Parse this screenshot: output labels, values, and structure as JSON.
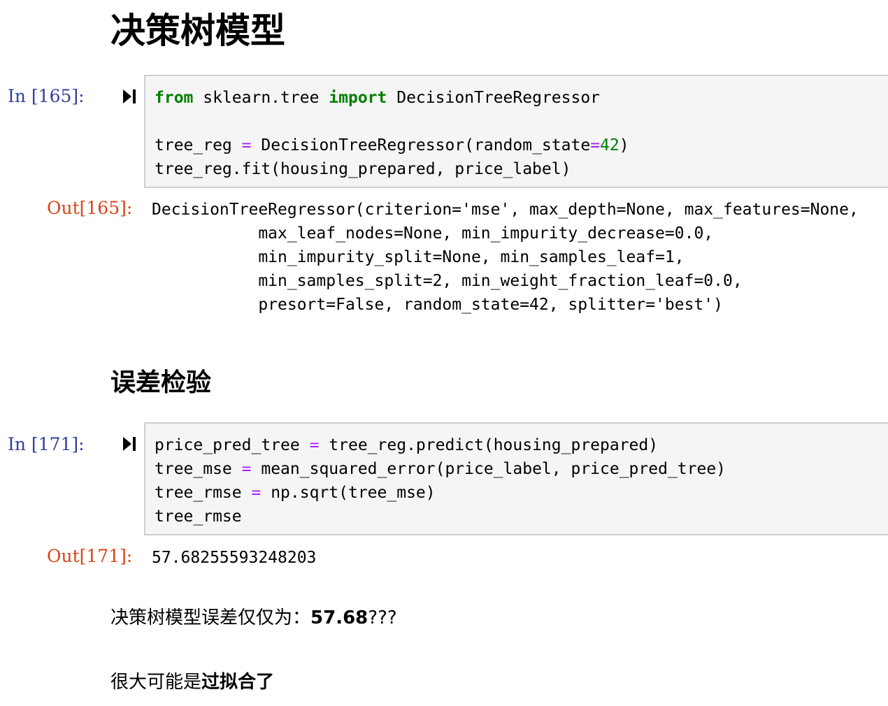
{
  "section1": {
    "heading": "决策树模型",
    "cell": {
      "in_prompt": "In [165]:",
      "code": {
        "l1_kw_from": "from",
        "l1_module": "sklearn.tree",
        "l1_kw_import": "import",
        "l1_name": "DecisionTreeRegressor",
        "l3_var": "tree_reg",
        "l3_op": "=",
        "l3_call": "DecisionTreeRegressor(random_state",
        "l3_op2": "=",
        "l3_num": "42",
        "l3_close": ")",
        "l4": "tree_reg.fit(housing_prepared, price_label)"
      },
      "out_prompt": "Out[165]:",
      "output": [
        "DecisionTreeRegressor(criterion='mse', max_depth=None, max_features=None,",
        "           max_leaf_nodes=None, min_impurity_decrease=0.0,",
        "           min_impurity_split=None, min_samples_leaf=1,",
        "           min_samples_split=2, min_weight_fraction_leaf=0.0,",
        "           presort=False, random_state=42, splitter='best')"
      ]
    }
  },
  "section2": {
    "heading": "误差检验",
    "cell": {
      "in_prompt": "In [171]:",
      "code": {
        "l1_a": "price_pred_tree",
        "l1_op": "=",
        "l1_b": "tree_reg.predict(housing_prepared)",
        "l2_a": "tree_mse",
        "l2_op": "=",
        "l2_b": "mean_squared_error(price_label, price_pred_tree)",
        "l3_a": "tree_rmse",
        "l3_op": "=",
        "l3_b": "np.sqrt(tree_mse)",
        "l4": "tree_rmse"
      },
      "out_prompt": "Out[171]:",
      "output": "57.68255593248203"
    }
  },
  "notes": {
    "p1_text": "决策树模型误差仅仅为：",
    "p1_bold": "57.68",
    "p1_tail": "???",
    "p2_text": "很大可能是",
    "p2_bold": "过拟合了"
  }
}
